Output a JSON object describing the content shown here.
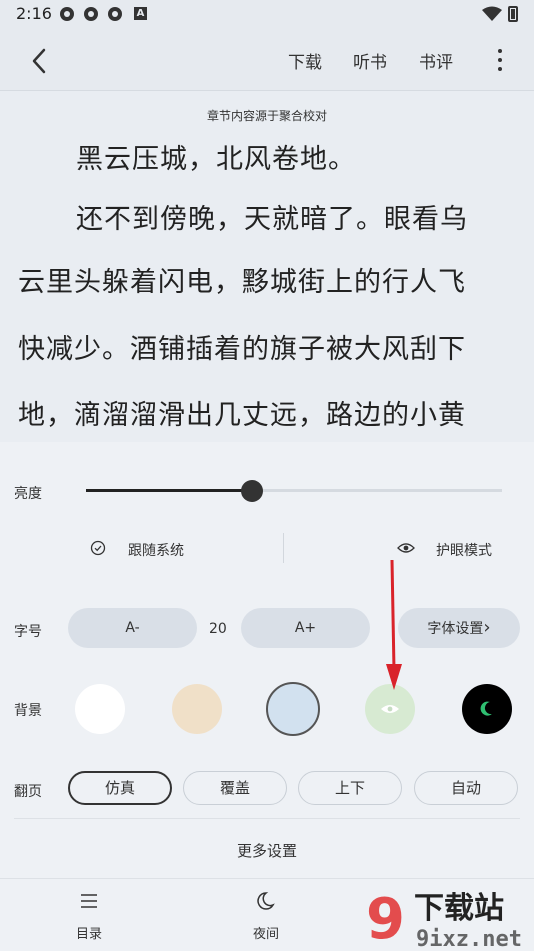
{
  "status": {
    "time": "2:16",
    "badge": "A"
  },
  "top_bar": {
    "download": "下载",
    "listen": "听书",
    "review": "书评"
  },
  "reader": {
    "chapter_source": "章节内容源于聚合校对",
    "lines": [
      "黑云压城，北风卷地。",
      "还不到傍晚，天就暗了。眼看乌",
      "云里头躲着闪电，黟城街上的行人飞",
      "快减少。酒铺插着的旗子被大风刮下",
      "地，滴溜溜滑出几丈远，路边的小黄"
    ]
  },
  "settings": {
    "brightness_label": "亮度",
    "brightness_level": 0.4,
    "follow_system": "跟随系统",
    "eye_care": "护眼模式",
    "font_size_label": "字号",
    "font_decrease": "A-",
    "font_size_value": "20",
    "font_increase": "A+",
    "font_settings": "字体设置",
    "font_settings_chevron": "›",
    "background_label": "背景",
    "backgrounds": [
      "#ffffff",
      "#f0e0c8",
      "#d2e1ef",
      "#d7ead2",
      "#000000"
    ],
    "selected_background": 2,
    "page_turn_label": "翻页",
    "page_modes": [
      "仿真",
      "覆盖",
      "上下",
      "自动"
    ],
    "selected_page_mode": 0,
    "more_settings": "更多设置"
  },
  "bottom_nav": {
    "toc": "目录",
    "night": "夜间"
  },
  "watermark": {
    "brand_number": "9",
    "brand_text": "下载站",
    "domain": "9ixz.net"
  },
  "colors": {
    "annotation_arrow": "#d9232a",
    "night_moon": "#2fbf71"
  }
}
